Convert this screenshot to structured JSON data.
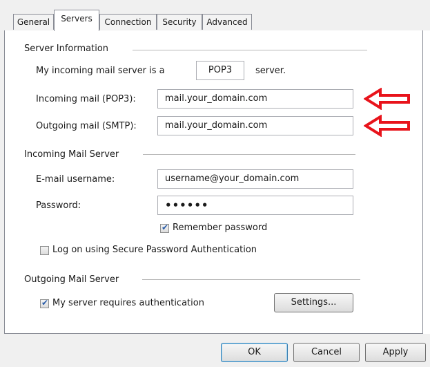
{
  "tabs": [
    "General",
    "Servers",
    "Connection",
    "Security",
    "Advanced"
  ],
  "active_tab": "Servers",
  "server_info": {
    "heading": "Server Information",
    "incoming_type_prefix": "My incoming mail server is a",
    "incoming_type_value": "POP3",
    "incoming_type_suffix": "server.",
    "incoming_label": "Incoming mail (POP3):",
    "incoming_value": "mail.your_domain.com",
    "outgoing_label": "Outgoing mail (SMTP):",
    "outgoing_value": "mail.your_domain.com"
  },
  "incoming_server": {
    "heading": "Incoming Mail Server",
    "username_label": "E-mail username:",
    "username_value": "username@your_domain.com",
    "password_label": "Password:",
    "password_value": "••••••",
    "remember_label": "Remember password",
    "remember_checked": true,
    "spa_label": "Log on using Secure Password Authentication",
    "spa_checked": false
  },
  "outgoing_server": {
    "heading": "Outgoing Mail Server",
    "auth_label": "My server requires authentication",
    "auth_checked": true,
    "settings_button": "Settings..."
  },
  "footer": {
    "ok": "OK",
    "cancel": "Cancel",
    "apply": "Apply"
  },
  "annotation_arrow_color": "#e8131b"
}
